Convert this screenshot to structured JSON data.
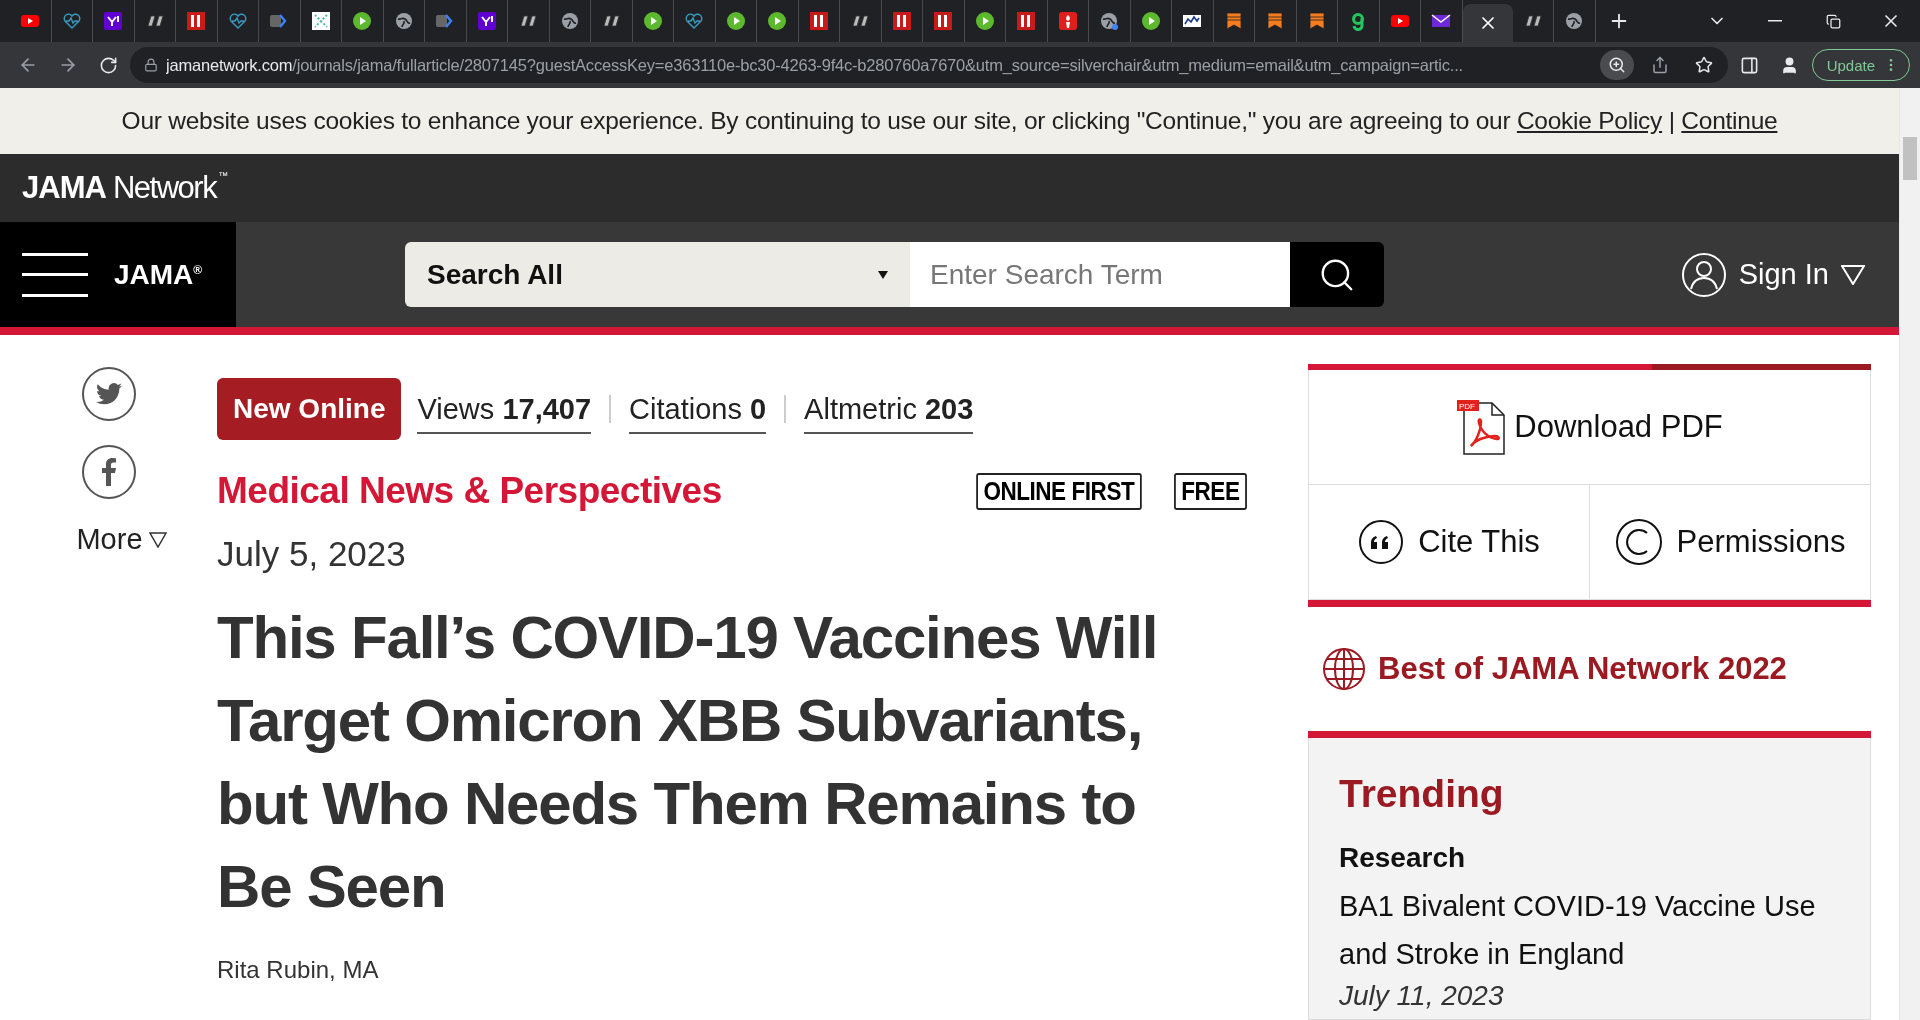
{
  "browser": {
    "tabs": [
      {
        "kind": "youtube",
        "selected": false
      },
      {
        "kind": "heart",
        "selected": false
      },
      {
        "kind": "yahoo",
        "selected": false
      },
      {
        "kind": "dr",
        "selected": false
      },
      {
        "kind": "bi",
        "selected": false
      },
      {
        "kind": "heart",
        "selected": false
      },
      {
        "kind": "arrow",
        "selected": false
      },
      {
        "kind": "grid",
        "selected": false
      },
      {
        "kind": "play",
        "selected": false
      },
      {
        "kind": "globe",
        "selected": false
      },
      {
        "kind": "arrow",
        "selected": false
      },
      {
        "kind": "yahoo",
        "selected": false
      },
      {
        "kind": "dr",
        "selected": false
      },
      {
        "kind": "globe",
        "selected": false
      },
      {
        "kind": "dr",
        "selected": false
      },
      {
        "kind": "play",
        "selected": false
      },
      {
        "kind": "heart",
        "selected": false
      },
      {
        "kind": "play",
        "selected": false
      },
      {
        "kind": "play",
        "selected": false
      },
      {
        "kind": "bi",
        "selected": false
      },
      {
        "kind": "dr",
        "selected": false
      },
      {
        "kind": "bi",
        "selected": false
      },
      {
        "kind": "bi",
        "selected": false
      },
      {
        "kind": "play",
        "selected": false
      },
      {
        "kind": "bi",
        "selected": false
      },
      {
        "kind": "torch",
        "selected": false
      },
      {
        "kind": "globe_dot",
        "selected": false
      },
      {
        "kind": "play",
        "selected": false
      },
      {
        "kind": "stock",
        "selected": false
      },
      {
        "kind": "bookmark",
        "selected": false
      },
      {
        "kind": "bookmark",
        "selected": false
      },
      {
        "kind": "bookmark",
        "selected": false
      },
      {
        "kind": "hook",
        "selected": false
      },
      {
        "kind": "youtube",
        "selected": false
      },
      {
        "kind": "mail",
        "selected": false
      },
      {
        "kind": "blank",
        "selected": true
      },
      {
        "kind": "dr",
        "selected": false
      },
      {
        "kind": "globe",
        "selected": false
      }
    ],
    "address": {
      "domain": "jamanetwork.com",
      "path": "/journals/jama/fullarticle/2807145?guestAccessKey=e363110e-bc30-4263-9f4c-b280760a7670&utm_source=silverchair&utm_medium=email&utm_campaign=artic..."
    },
    "update_button": "Update"
  },
  "cookie_banner": {
    "text": "Our website uses cookies to enhance your experience. By continuing to use our site, or clicking \"Continue,\" you are agreeing to our",
    "policy_link": "Cookie Policy",
    "separator": "|",
    "continue_link": "Continue"
  },
  "network_bar": {
    "logo": "JAMA",
    "logo_rest": "Network",
    "trademark": "™"
  },
  "nav": {
    "journal": "JAMA",
    "journal_mark": "®",
    "search_scope": "Search All",
    "search_placeholder": "Enter Search Term",
    "sign_in": "Sign In"
  },
  "share": {
    "more": "More"
  },
  "article": {
    "badge": "New Online",
    "metrics": [
      {
        "label": "Views",
        "value": "17,407"
      },
      {
        "label": "Citations",
        "value": "0"
      },
      {
        "label": "Altmetric",
        "value": "203"
      }
    ],
    "section": "Medical News & Perspectives",
    "tags": [
      "ONLINE FIRST",
      "FREE"
    ],
    "date": "July 5, 2023",
    "title": "This Fall’s COVID-19 Vaccines Will Target Omicron XBB Subvariants, but Who Needs Them Remains to Be Seen",
    "author": "Rita Rubin, MA"
  },
  "sidebar": {
    "download": "Download PDF",
    "pdf_badge": "PDF",
    "cite": "Cite This",
    "permissions": "Permissions",
    "best_of": "Best of JAMA Network 2022",
    "trending": {
      "heading": "Trending",
      "category": "Research",
      "article": "BA1 Bivalent COVID-19 Vaccine Use and Stroke in England",
      "date": "July 11, 2023"
    }
  }
}
